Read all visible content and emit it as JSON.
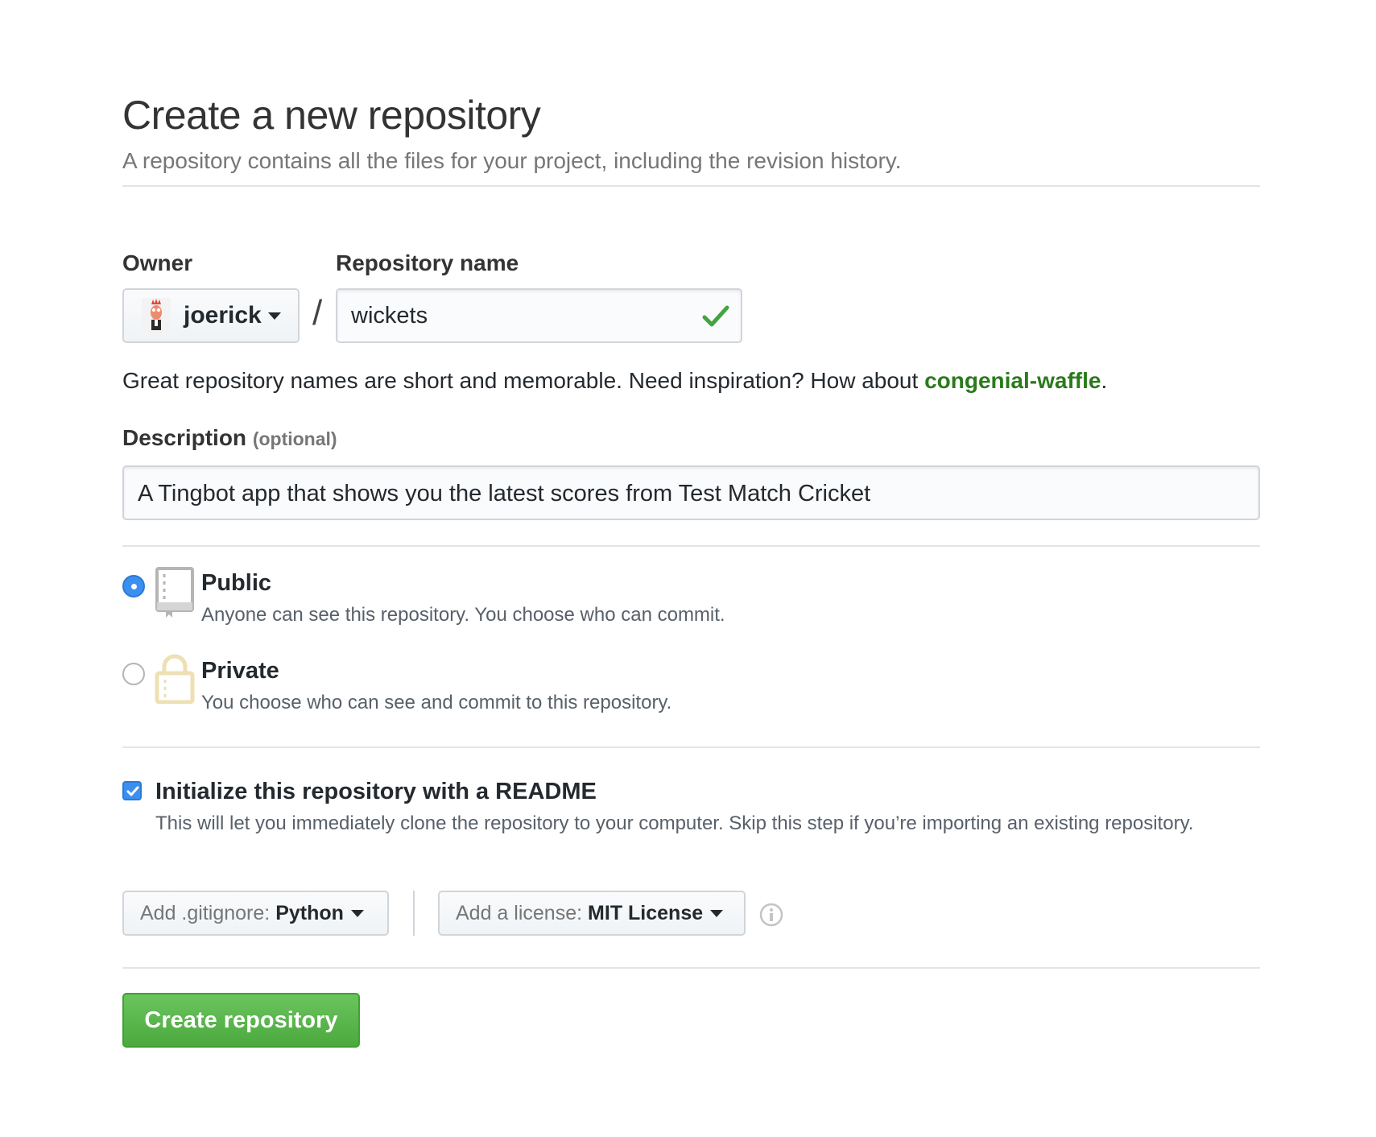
{
  "header": {
    "title": "Create a new repository",
    "subtitle": "A repository contains all the files for your project, including the revision history."
  },
  "owner": {
    "label": "Owner",
    "value": "joerick",
    "avatar_icon": "muppet-avatar-icon"
  },
  "separator": "/",
  "repo_name": {
    "label": "Repository name",
    "value": "wickets",
    "valid_icon": "check-icon",
    "valid_color": "#45a342"
  },
  "hint": {
    "prefix": "Great repository names are short and memorable. Need inspiration? How about ",
    "suggestion": "congenial-waffle",
    "suffix": "."
  },
  "description": {
    "label": "Description",
    "optional": "(optional)",
    "value": "A Tingbot app that shows you the latest scores from Test Match Cricket"
  },
  "visibility": {
    "selected": "public",
    "public": {
      "title": "Public",
      "desc": "Anyone can see this repository. You choose who can commit.",
      "icon": "repo-book-icon"
    },
    "private": {
      "title": "Private",
      "desc": "You choose who can see and commit to this repository.",
      "icon": "lock-icon"
    }
  },
  "readme": {
    "checked": true,
    "title": "Initialize this repository with a README",
    "desc": "This will let you immediately clone the repository to your computer. Skip this step if you’re importing an existing repository."
  },
  "gitignore": {
    "prefix": "Add .gitignore:",
    "value": "Python"
  },
  "license": {
    "prefix": "Add a license:",
    "value": "MIT License",
    "info_icon": "info-icon"
  },
  "submit": {
    "label": "Create repository",
    "color": "#4ba93e"
  }
}
